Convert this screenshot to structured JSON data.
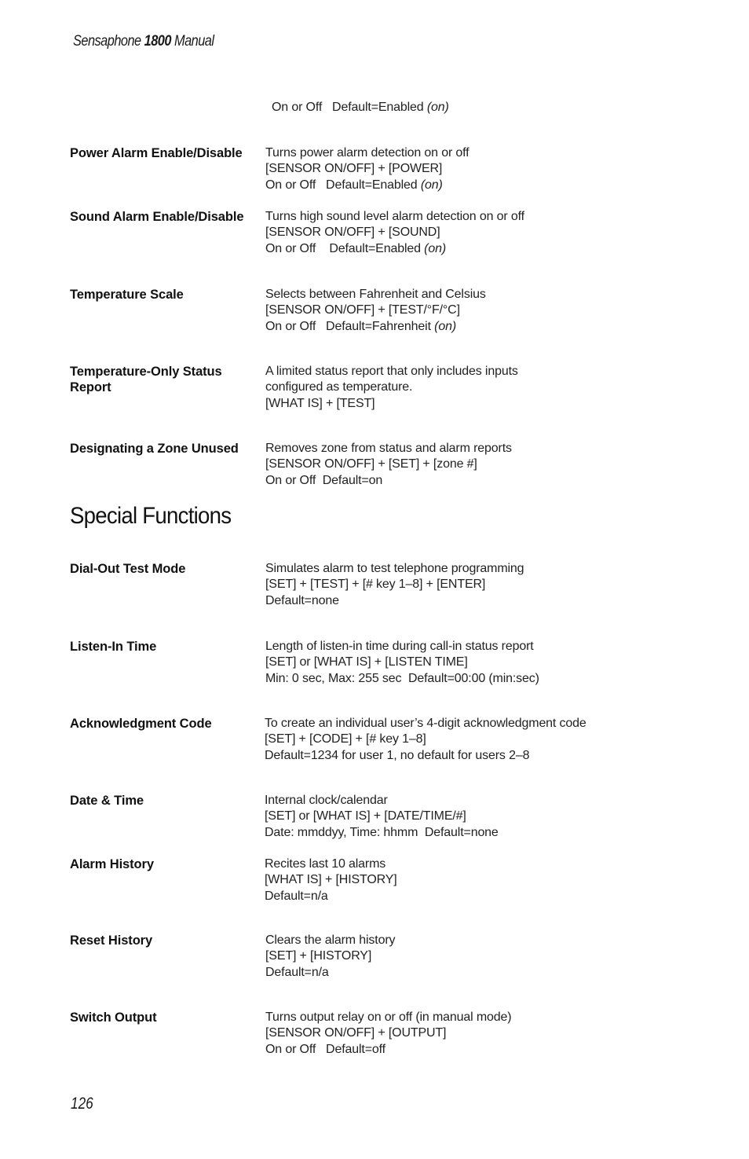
{
  "header": {
    "brand": "Sensaphone",
    "model": "1800",
    "suffix": "Manual"
  },
  "continuation": {
    "prefix": "On or Off   Default=Enabled ",
    "italic": "(on)"
  },
  "entries_top": [
    {
      "term": "Power Alarm Enable/Disable",
      "lines": [
        "Turns power alarm detection on or off",
        "[SENSOR ON/OFF] + [POWER]"
      ],
      "last_prefix": "On or Off   Default=Enabled ",
      "last_italic": "(on)"
    },
    {
      "term": "Sound Alarm Enable/Disable",
      "lines": [
        "Turns high sound level alarm detection on or off",
        "[SENSOR ON/OFF] + [SOUND]"
      ],
      "last_prefix": "On or Off    Default=Enabled ",
      "last_italic": "(on)"
    },
    {
      "term": "Temperature Scale",
      "lines": [
        "Selects between Fahrenheit and Celsius",
        "[SENSOR ON/OFF] + [TEST/°F/°C]"
      ],
      "last_prefix": "On or Off   Default=Fahrenheit ",
      "last_italic": "(on)"
    },
    {
      "term_lines": [
        "Temperature-Only Status",
        "Report"
      ],
      "lines": [
        "A limited status report that only includes inputs",
        "configured as temperature.",
        "[WHAT IS] + [TEST]"
      ]
    },
    {
      "term": "Designating a Zone Unused",
      "lines": [
        "Removes zone from status and alarm reports",
        "[SENSOR ON/OFF] + [SET] + [zone #]",
        "On or Off  Default=on"
      ]
    }
  ],
  "section": {
    "title": "Special Functions"
  },
  "entries_special": [
    {
      "term": "Dial-Out Test Mode",
      "lines": [
        "Simulates alarm to test telephone programming",
        "[SET] + [TEST] + [# key 1–8] + [ENTER]",
        "Default=none"
      ]
    },
    {
      "term": "Listen-In Time",
      "lines": [
        "Length of listen-in time during call-in status report",
        "[SET] or [WHAT IS] + [LISTEN TIME]",
        "Min: 0 sec, Max: 255 sec  Default=00:00 (min:sec)"
      ]
    },
    {
      "term": "Acknowledgment Code",
      "lines": [
        "To create an individual user’s 4-digit acknowledgment code",
        "[SET] + [CODE] + [# key 1–8]",
        "Default=1234 for user 1, no default for users 2–8"
      ]
    },
    {
      "term": "Date & Time",
      "lines": [
        "Internal clock/calendar",
        "[SET] or [WHAT IS] + [DATE/TIME/#]",
        "Date: mmddyy, Time: hhmm  Default=none"
      ]
    },
    {
      "term": "Alarm History",
      "lines": [
        "Recites last 10 alarms",
        "[WHAT IS] + [HISTORY]",
        "Default=n/a"
      ]
    },
    {
      "term": "Reset History",
      "lines": [
        "Clears the alarm history",
        "[SET] + [HISTORY]",
        "Default=n/a"
      ]
    },
    {
      "term": "Switch Output",
      "lines": [
        "Turns output relay on or off (in manual mode)",
        "[SENSOR ON/OFF] + [OUTPUT]",
        "On or Off   Default=off"
      ]
    }
  ],
  "footer": {
    "page_number": "126"
  }
}
